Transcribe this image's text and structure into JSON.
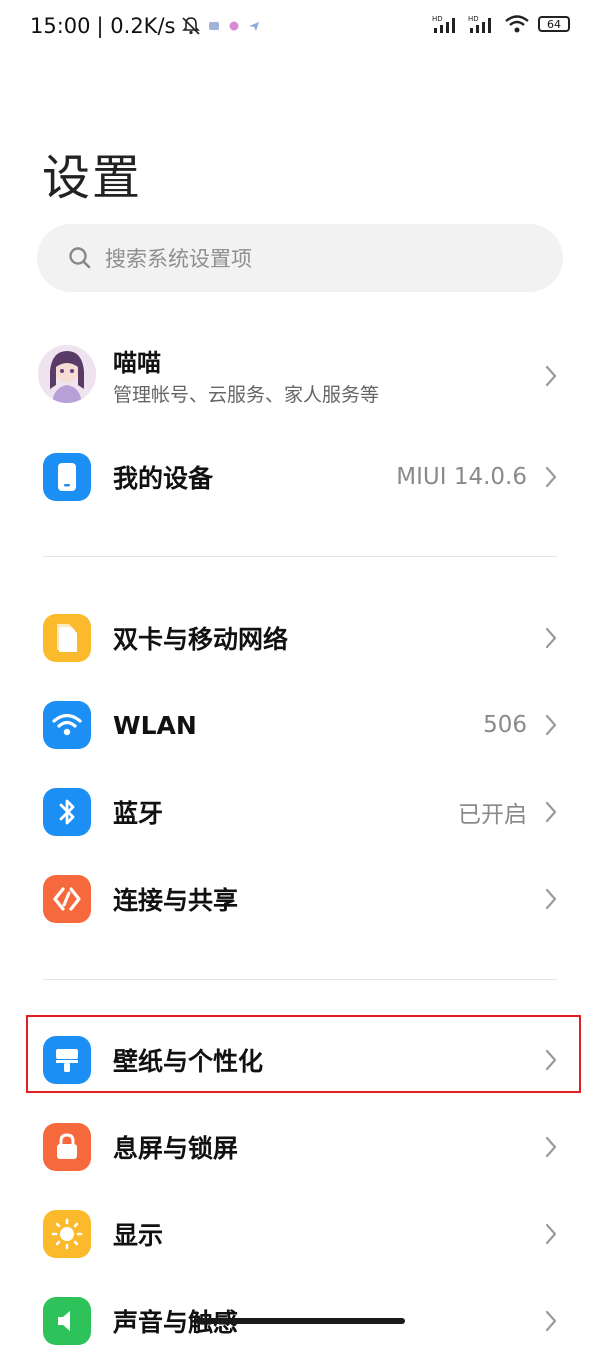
{
  "status_bar": {
    "time": "15:00",
    "net_speed": "| 0.2K/s",
    "hd1": "HD",
    "hd2": "HD",
    "battery": "64"
  },
  "page_title": "设置",
  "search": {
    "placeholder": "搜索系统设置项"
  },
  "profile": {
    "name": "喵喵",
    "subtitle": "管理帐号、云服务、家人服务等"
  },
  "items": [
    {
      "id": "my-device",
      "label": "我的设备",
      "value": "MIUI 14.0.6",
      "icon": "phone-icon",
      "color": "#1c8ff5"
    },
    {
      "id": "dual-sim",
      "label": "双卡与移动网络",
      "value": "",
      "icon": "sim-card-icon",
      "color": "#fbb92c"
    },
    {
      "id": "wlan",
      "label": "WLAN",
      "value": "506",
      "icon": "wifi-icon",
      "color": "#1c8ff5"
    },
    {
      "id": "bluetooth",
      "label": "蓝牙",
      "value": "已开启",
      "icon": "bluetooth-icon",
      "color": "#1c8ff5"
    },
    {
      "id": "connection-sharing",
      "label": "连接与共享",
      "value": "",
      "icon": "connection-icon",
      "color": "#f5693d"
    },
    {
      "id": "wallpaper",
      "label": "壁纸与个性化",
      "value": "",
      "icon": "paint-brush-icon",
      "color": "#1c8ff5"
    },
    {
      "id": "lock-screen",
      "label": "息屏与锁屏",
      "value": "",
      "icon": "lock-icon",
      "color": "#f5693d"
    },
    {
      "id": "display",
      "label": "显示",
      "value": "",
      "icon": "sun-icon",
      "color": "#fbb92c"
    },
    {
      "id": "sound",
      "label": "声音与触感",
      "value": "",
      "icon": "speaker-icon",
      "color": "#2ec25b"
    }
  ],
  "colors": {
    "accent_blue": "#1c8ff5",
    "accent_yellow": "#fbb92c",
    "accent_orange": "#f5693d",
    "accent_green": "#2ec25b",
    "highlight_red": "#e02020"
  }
}
